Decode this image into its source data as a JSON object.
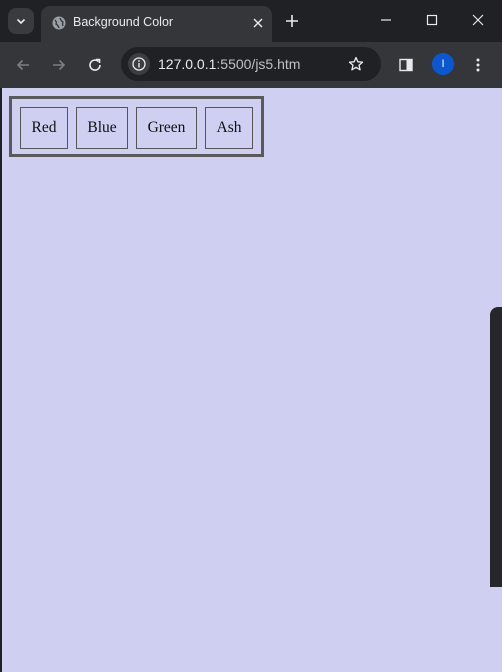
{
  "tab": {
    "title": "Background Color"
  },
  "toolbar": {
    "url_host": "127.0.0.1",
    "url_path": ":5500/js5.htm",
    "profile_initial": "I"
  },
  "page": {
    "background": "#cfcff1",
    "buttons": [
      "Red",
      "Blue",
      "Green",
      "Ash"
    ]
  }
}
